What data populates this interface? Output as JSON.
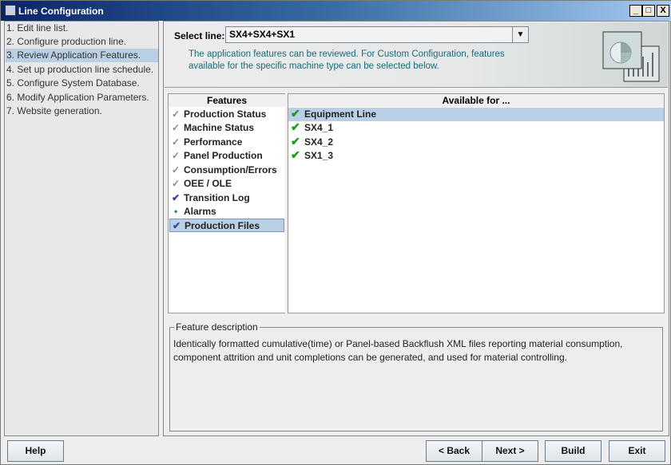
{
  "window": {
    "title": "Line Configuration",
    "minimize": "_",
    "maximize": "□",
    "close": "X"
  },
  "steps": [
    "1. Edit line list.",
    "2. Configure production line.",
    "3. Review Application Features.",
    "4. Set up production line schedule.",
    "5. Configure System Database.",
    "6. Modify Application Parameters.",
    "7. Website generation."
  ],
  "select_line": {
    "label": "Select line:",
    "value": "SX4+SX4+SX1"
  },
  "hint": "The application features can be reviewed. For Custom Configuration, features available for the specific machine type can be selected below.",
  "features": {
    "header": "Features",
    "items": [
      {
        "label": "Production Status",
        "state": "gray"
      },
      {
        "label": "Machine Status",
        "state": "gray"
      },
      {
        "label": "Performance",
        "state": "gray"
      },
      {
        "label": "Panel Production",
        "state": "gray"
      },
      {
        "label": "Consumption/Errors",
        "state": "gray"
      },
      {
        "label": "OEE / OLE",
        "state": "gray"
      },
      {
        "label": "Transition Log",
        "state": "blue"
      },
      {
        "label": "Alarms",
        "state": "dot"
      },
      {
        "label": "Production Files",
        "state": "blue"
      }
    ]
  },
  "available": {
    "header": "Available for ...",
    "items": [
      "Equipment Line",
      "SX4_1",
      "SX4_2",
      "SX1_3"
    ]
  },
  "description": {
    "title": "Feature description",
    "text": "Identically formatted cumulative(time) or Panel-based Backflush XML files reporting material consumption, component attrition and unit completions can be generated, and used for material controlling."
  },
  "buttons": {
    "help": "Help",
    "back": "< Back",
    "next": "Next >",
    "build": "Build",
    "exit": "Exit"
  },
  "colors": {
    "selection": "#b8cfe5",
    "hint": "#1a6a7a",
    "check_green": "#1a9a1a",
    "check_blue": "#3a3ab0"
  }
}
